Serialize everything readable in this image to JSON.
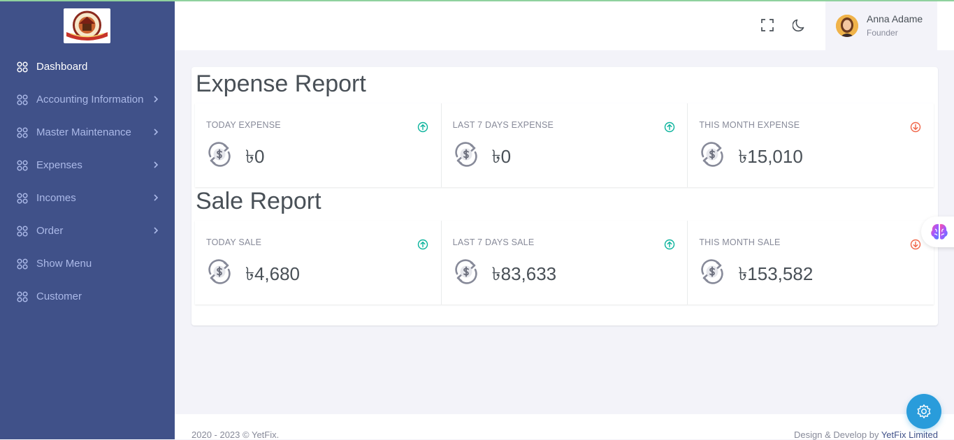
{
  "sidebar": {
    "items": [
      {
        "label": "Dashboard",
        "active": true,
        "has_submenu": false
      },
      {
        "label": "Accounting Information",
        "active": false,
        "has_submenu": true
      },
      {
        "label": "Master Maintenance",
        "active": false,
        "has_submenu": true
      },
      {
        "label": "Expenses",
        "active": false,
        "has_submenu": true
      },
      {
        "label": "Incomes",
        "active": false,
        "has_submenu": true
      },
      {
        "label": "Order",
        "active": false,
        "has_submenu": true
      },
      {
        "label": "Show Menu",
        "active": false,
        "has_submenu": false
      },
      {
        "label": "Customer",
        "active": false,
        "has_submenu": false
      }
    ]
  },
  "header": {
    "icons": [
      "fullscreen-icon",
      "moon-icon"
    ],
    "user": {
      "name": "Anna Adame",
      "role": "Founder"
    }
  },
  "expense_report": {
    "title": "Expense Report",
    "stats": [
      {
        "label": "TODAY EXPENSE",
        "value": "৳0",
        "trend": "up"
      },
      {
        "label": "LAST 7 DAYS EXPENSE",
        "value": "৳0",
        "trend": "up"
      },
      {
        "label": "THIS MONTH EXPENSE",
        "value": "৳15,010",
        "trend": "down"
      }
    ]
  },
  "sale_report": {
    "title": "Sale Report",
    "stats": [
      {
        "label": "TODAY SALE",
        "value": "৳4,680",
        "trend": "up"
      },
      {
        "label": "LAST 7 DAYS SALE",
        "value": "৳83,633",
        "trend": "up"
      },
      {
        "label": "THIS MONTH SALE",
        "value": "৳153,582",
        "trend": "down"
      }
    ]
  },
  "footer": {
    "copyright": "2020 - 2023 © YetFix.",
    "credit_prefix": "Design & Develop by ",
    "credit_link": "YetFix Limited"
  },
  "colors": {
    "sidebar_bg": "#405189",
    "trend_up": "#0ab39c",
    "trend_down": "#f06548",
    "fab": "#299cdb"
  }
}
